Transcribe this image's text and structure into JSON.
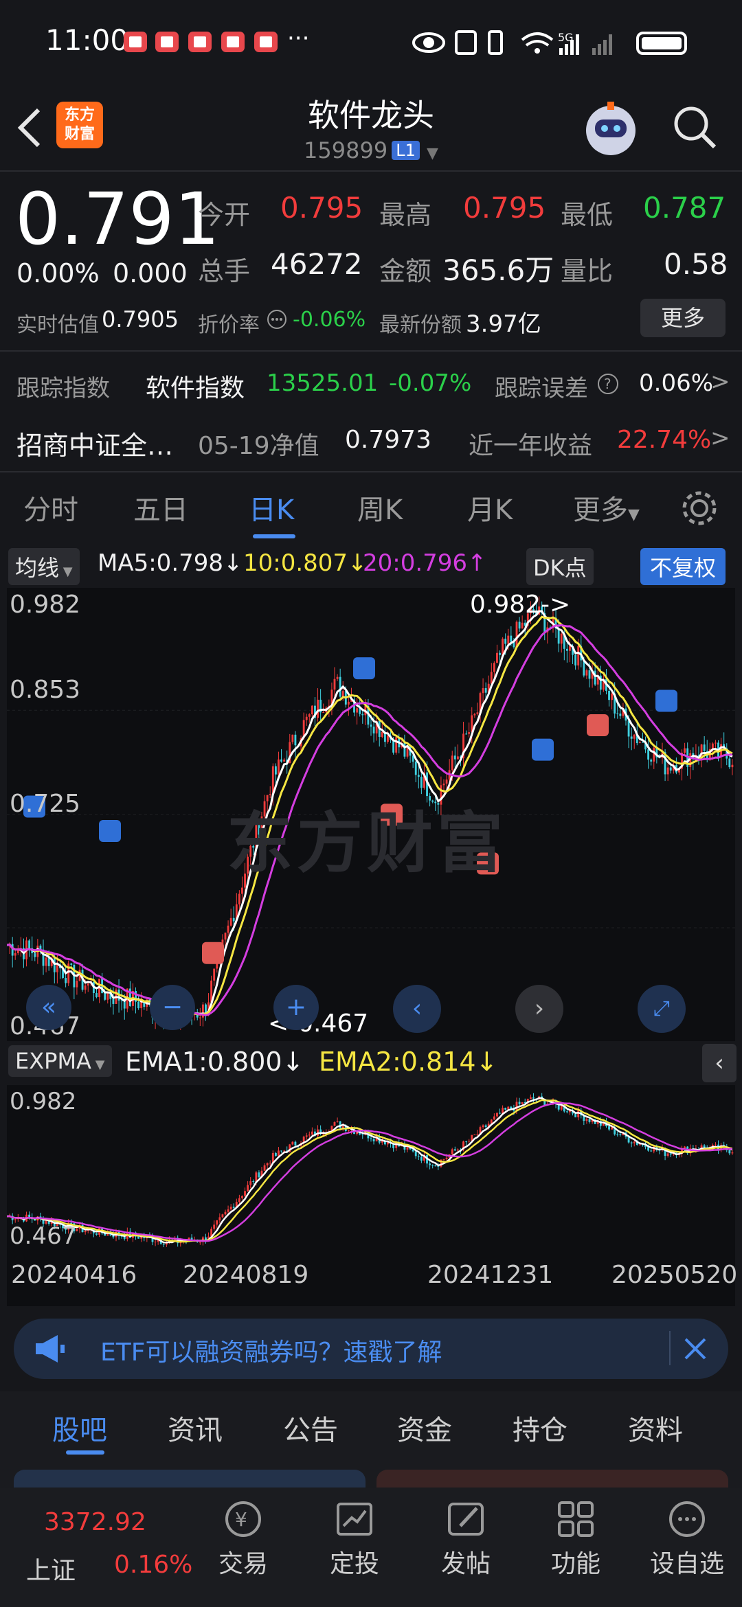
{
  "status_bar": {
    "time": "11:00",
    "ellipsis": "···",
    "network": "5G"
  },
  "header": {
    "title": "软件龙头",
    "code": "159899",
    "level": "L1"
  },
  "quote": {
    "price": "0.791",
    "change_pct": "0.00%",
    "change_abs": "0.000",
    "open_label": "今开",
    "open": "0.795",
    "high_label": "最高",
    "high": "0.795",
    "low_label": "最低",
    "low": "0.787",
    "volume_label": "总手",
    "volume": "46272",
    "amount_label": "金额",
    "amount": "365.6万",
    "ratio_label": "量比",
    "ratio": "0.58",
    "iopv_label": "实时估值",
    "iopv": "0.7905",
    "premium_label": "折价率",
    "premium": "-0.06%",
    "shares_label": "最新份额",
    "shares": "3.97亿",
    "more_label": "更多"
  },
  "tracking": {
    "label": "跟踪指数",
    "index_name": "软件指数",
    "index_value": "13525.01",
    "index_change": "-0.07%",
    "error_label": "跟踪误差",
    "error_value": "0.06%"
  },
  "fund": {
    "name": "招商中证全…",
    "nav_label": "05-19净值",
    "nav": "0.7973",
    "return_label": "近一年收益",
    "return": "22.74%"
  },
  "chart_tabs": [
    "分时",
    "五日",
    "日K",
    "周K",
    "月K",
    "更多"
  ],
  "chart_tab_active": 2,
  "kline": {
    "ma_selector": "均线",
    "ma5": "MA5:0.798↓",
    "ma10": "10:0.807↓",
    "ma20": "20:0.796↑",
    "dk_label": "DK点",
    "adjust_label": "不复权",
    "y_top": "0.982",
    "y_mid1": "0.853",
    "y_mid2": "0.725",
    "y_bottom": "0.467",
    "marker_high": "0.982->",
    "marker_low": "<-0.467",
    "watermark": "东方财富"
  },
  "ema": {
    "selector": "EXPMA",
    "ema1": "EMA1:0.800↓",
    "ema2": "EMA2:0.814↓",
    "y_top": "0.982",
    "y_bottom": "0.467"
  },
  "dates": [
    "20240416",
    "20240819",
    "20241231",
    "20250520"
  ],
  "chart_data": {
    "type": "line",
    "x": [
      "20240416",
      "20240819",
      "20241231",
      "20250520"
    ],
    "ylim": [
      0.467,
      0.982
    ],
    "series": [
      {
        "name": "EMA1",
        "values": [
          0.56,
          0.49,
          0.86,
          0.8
        ]
      },
      {
        "name": "EMA2",
        "values": [
          0.57,
          0.5,
          0.84,
          0.81
        ]
      }
    ]
  },
  "banner": {
    "text": "ETF可以融资融券吗？速戳了解"
  },
  "bottom_tabs": [
    "股吧",
    "资讯",
    "公告",
    "资金",
    "持仓",
    "资料"
  ],
  "bottom_tab_active": 0,
  "market": {
    "name": "上证",
    "value": "3372.92",
    "change": "0.16%"
  },
  "nav": [
    "交易",
    "定投",
    "发帖",
    "功能",
    "设自选"
  ],
  "colors": {
    "up": "#f23c3c",
    "down": "#2bd04a",
    "accent": "#4a8cf0",
    "ma10": "#f5e642",
    "ma20": "#d43ee0"
  }
}
